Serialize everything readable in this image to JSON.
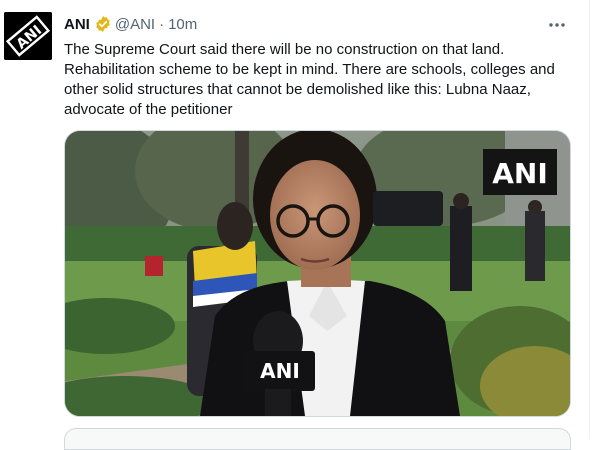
{
  "tweet": {
    "author_name": "ANI",
    "handle": "@ANI",
    "separator": "·",
    "time": "10m",
    "text": "The Supreme Court said there will be no construction on that land.\nRehabilitation scheme to be kept in mind. There are schools, colleges and\nother solid structures that cannot be demolished like this: Lubna Naaz,\nadvocate of the petitioner",
    "avatar_logo_text": "ANI",
    "media_watermark": "ANI",
    "mic_label": "ANI",
    "icons": {
      "verified": "verified-badge-icon",
      "more": "more-options-icon"
    },
    "colors": {
      "verified_badge": "#e2b719",
      "secondary_text": "#536471"
    }
  }
}
